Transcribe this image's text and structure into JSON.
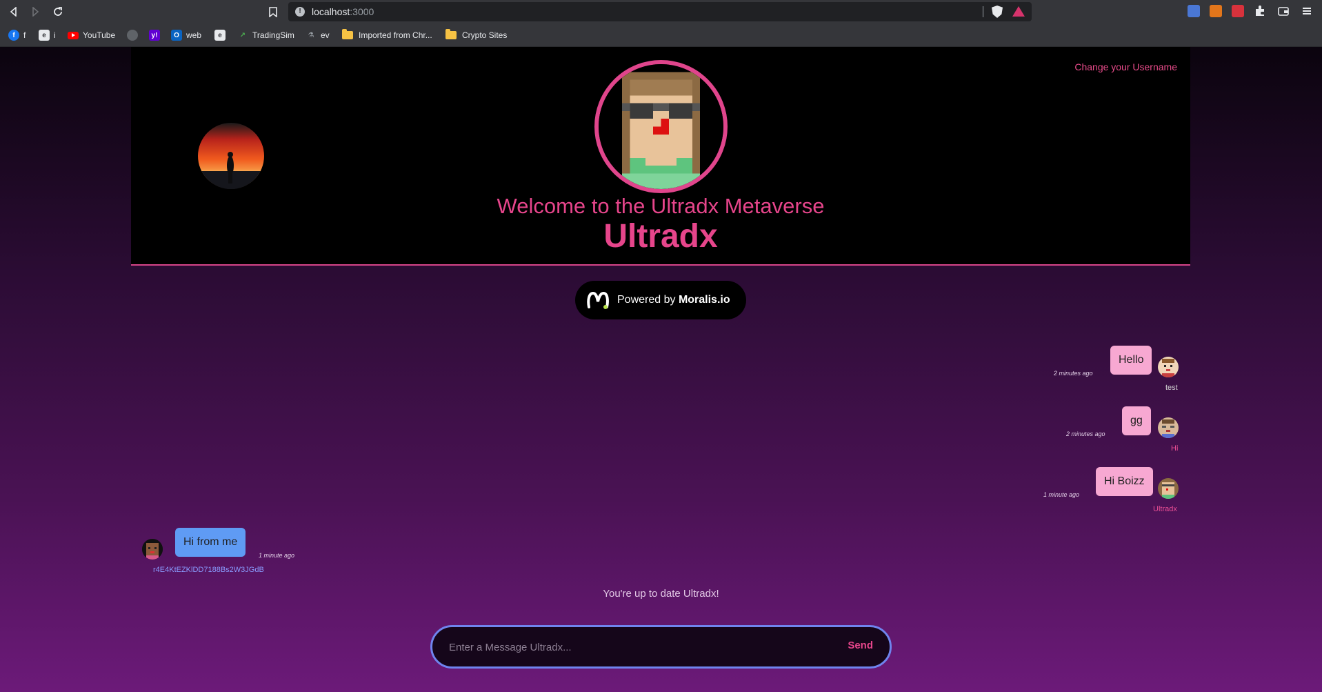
{
  "browser": {
    "url_host": "localhost",
    "url_port": ":3000",
    "bookmarks": [
      {
        "label": "f",
        "icon": "facebook-icon",
        "color": "#1877f2"
      },
      {
        "label": "i",
        "icon": "grammarly-icon",
        "color": "#e8eaed"
      },
      {
        "label": "YouTube",
        "icon": "youtube-icon",
        "color": "#ff0000"
      },
      {
        "label": "",
        "icon": "globe-icon",
        "color": "#9aa0a6"
      },
      {
        "label": "",
        "icon": "yahoo-icon",
        "color": "#6001d2"
      },
      {
        "label": "web",
        "icon": "outlook-icon",
        "color": "#0a64c2"
      },
      {
        "label": "",
        "icon": "grammarly-icon",
        "color": "#e8eaed"
      },
      {
        "label": "TradingSim",
        "icon": "tradingsim-icon",
        "color": "#4caf50"
      },
      {
        "label": "ev",
        "icon": "flask-icon",
        "color": "#9aa0a6"
      },
      {
        "label": "Imported from Chr...",
        "icon": "folder-icon",
        "color": "#f6c244"
      },
      {
        "label": "Crypto Sites",
        "icon": "folder-icon",
        "color": "#f6c244"
      }
    ]
  },
  "header": {
    "change_username": "Change your Username",
    "welcome": "Welcome to the Ultradx Metaverse",
    "username": "Ultradx"
  },
  "powered_by": {
    "prefix": "Powered by ",
    "brand": "Moralis.io"
  },
  "messages": [
    {
      "text": "Hello",
      "time": "2 minutes ago",
      "user": "test",
      "side": "right"
    },
    {
      "text": "gg",
      "time": "2 minutes ago",
      "user": "Hi",
      "side": "right"
    },
    {
      "text": "Hi Boizz",
      "time": "1 minute ago",
      "user": "Ultradx",
      "side": "right"
    },
    {
      "text": "Hi from me",
      "time": "1 minute ago",
      "user": "r4E4KtEZKlDD7188Bs2W3JGdB",
      "side": "left"
    }
  ],
  "status": "You're up to date Ultradx!",
  "composer": {
    "placeholder": "Enter a Message Ultradx...",
    "send_label": "Send"
  },
  "colors": {
    "accent_pink": "#e6458b",
    "mine_bubble": "#f7a8d2",
    "other_bubble": "#5f9bf4",
    "input_border": "#6f84ee"
  }
}
